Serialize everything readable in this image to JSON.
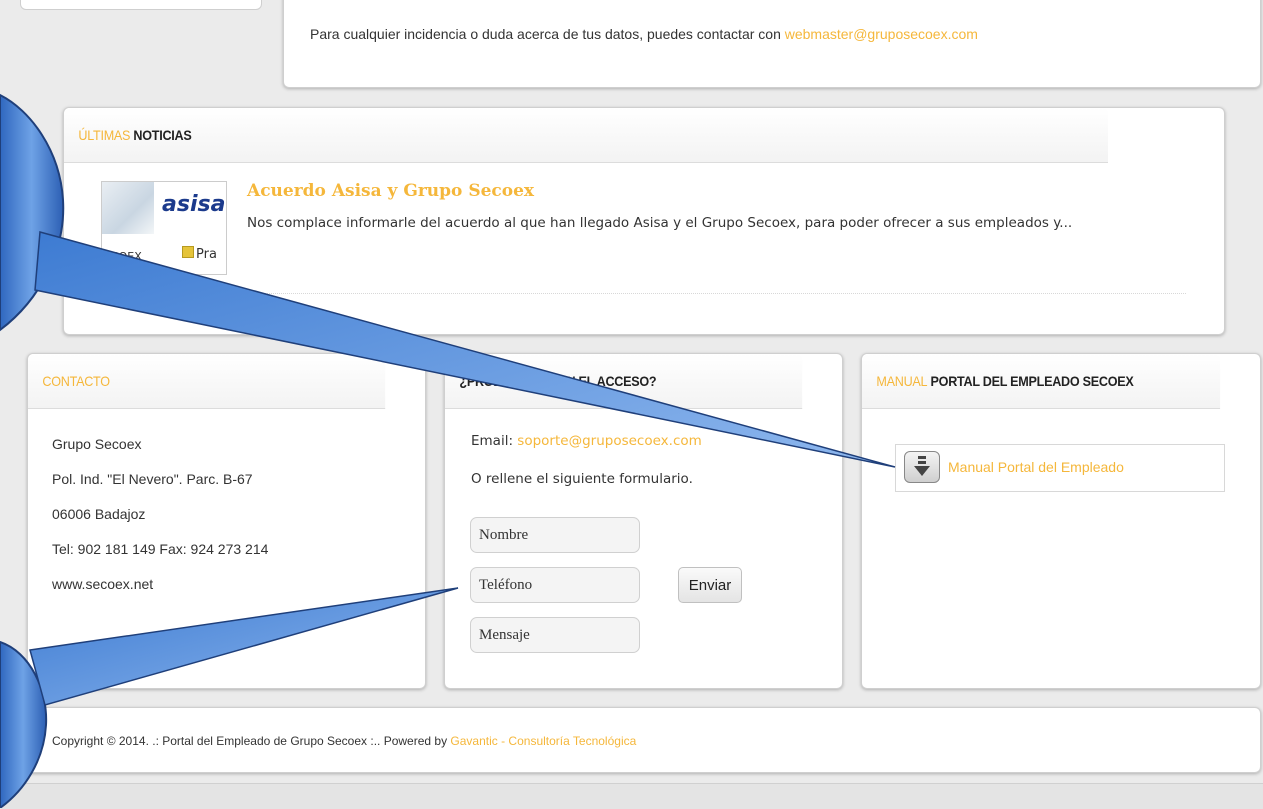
{
  "top_notice": {
    "text": "Para cualquier incidencia o duda acerca de tus datos, puedes contactar con ",
    "email": "webmaster@gruposecoex.com"
  },
  "news": {
    "title_accent": "ÚLTIMAS",
    "title_rest": "NOTICIAS",
    "thumb_brand": "asisa",
    "thumb_left": "ECOEX",
    "thumb_right": "Pra",
    "item_title": "Acuerdo Asisa y Grupo Secoex",
    "item_excerpt": "Nos complace informarle del acuerdo al que han llegado Asisa y el Grupo Secoex, para poder ofrecer a sus empleados y..."
  },
  "contact": {
    "title": "CONTACTO",
    "lines": [
      "Grupo Secoex",
      "Pol. Ind. \"El Nevero\". Parc. B-67",
      "06006 Badajoz",
      "Tel: 902 181 149 Fax: 924 273 214",
      "www.secoex.net"
    ]
  },
  "access": {
    "title": "¿PROBLEMAS CON EL ACCESO?",
    "email_label": "Email: ",
    "email": "soporte@gruposecoex.com",
    "form_intro": "O rellene el siguiente formulario.",
    "placeholders": {
      "name": "Nombre",
      "phone": "Teléfono",
      "message": "Mensaje"
    },
    "send_label": "Enviar"
  },
  "manual": {
    "title_accent": "MANUAL",
    "title_rest": "PORTAL DEL EMPLEADO SECOEX",
    "download_label": "Manual Portal del Empleado",
    "icon": "download-icon"
  },
  "footer": {
    "text": "Copyright © 2014. .: Portal del Empleado de Grupo Secoex :.. Powered by ",
    "link": "Gavantic - Consultoría Tecnológica"
  },
  "colors": {
    "accent": "#f5b73b",
    "callout_blue": "#3f7fd0"
  }
}
